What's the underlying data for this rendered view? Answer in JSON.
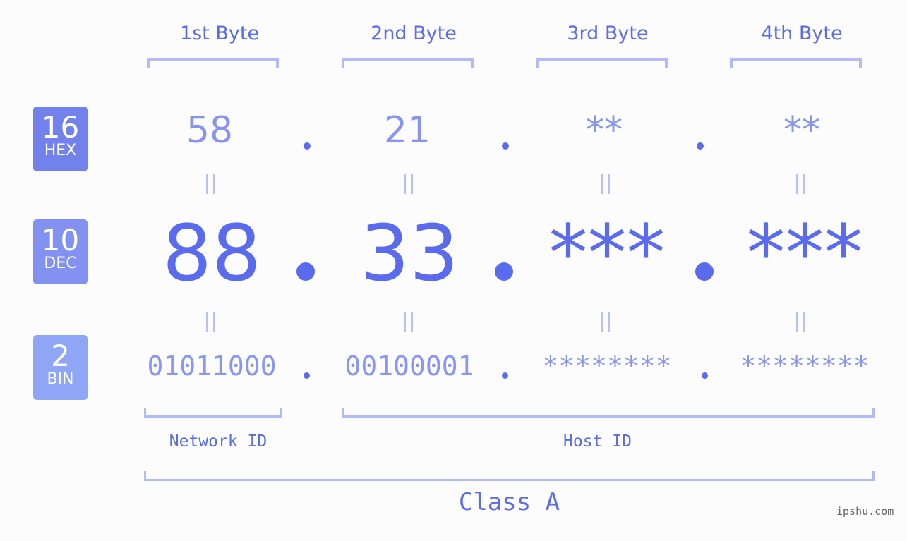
{
  "bytes": [
    {
      "header": "1st Byte",
      "hex": "58",
      "dec": "88",
      "bin": "01011000"
    },
    {
      "header": "2nd Byte",
      "hex": "21",
      "dec": "33",
      "bin": "00100001"
    },
    {
      "header": "3rd Byte",
      "hex": "**",
      "dec": "***",
      "bin": "********"
    },
    {
      "header": "4th Byte",
      "hex": "**",
      "dec": "***",
      "bin": "********"
    }
  ],
  "bases": [
    {
      "number": "16",
      "label": "HEX",
      "color": "#7281ec"
    },
    {
      "number": "10",
      "label": "DEC",
      "color": "#8392f1"
    },
    {
      "number": "2",
      "label": "BIN",
      "color": "#8fa6f7"
    }
  ],
  "network_label": "Network ID",
  "host_label": "Host ID",
  "class_label": "Class A",
  "watermark": "ipshu.com",
  "colors": {
    "accent": "#5a6ced",
    "bracket": "#b2bbf6",
    "background": "#fbfcfb"
  }
}
